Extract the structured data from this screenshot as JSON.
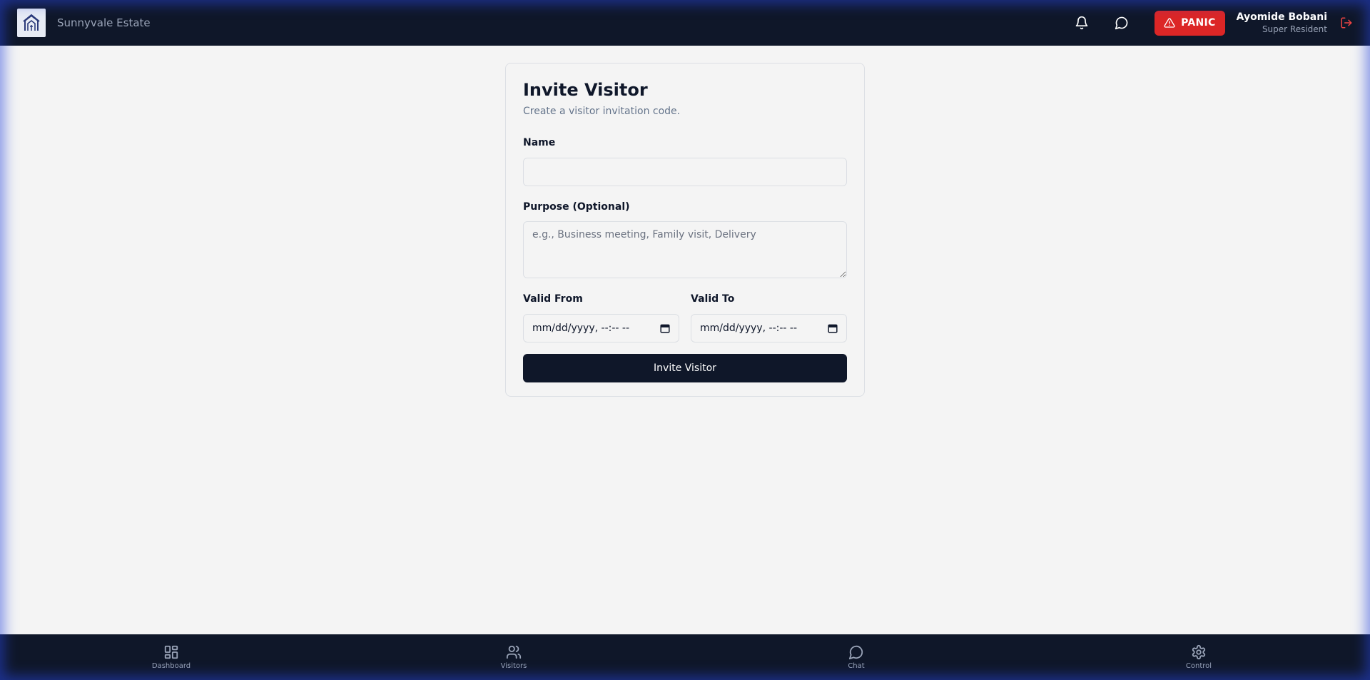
{
  "header": {
    "estate_name": "Sunnyvale Estate",
    "logo_icon": "estate-house-icon",
    "notification_icon": "bell-icon",
    "chat_icon": "chat-bubble-icon",
    "panic_label": "PANIC",
    "panic_icon": "warning-triangle-icon",
    "user_name": "Ayomide Bobani",
    "user_role": "Super Resident",
    "logout_icon": "logout-icon"
  },
  "form": {
    "title": "Invite Visitor",
    "subtitle": "Create a visitor invitation code.",
    "name_label": "Name",
    "name_value": "",
    "purpose_label": "Purpose (Optional)",
    "purpose_placeholder": "e.g., Business meeting, Family visit, Delivery",
    "valid_from_label": "Valid From",
    "valid_from_value": "mm/dd/yyyy, --:-- --",
    "valid_to_label": "Valid To",
    "valid_to_value": "mm/dd/yyyy, --:-- --",
    "calendar_icon": "calendar-icon",
    "submit_label": "Invite Visitor"
  },
  "bottom_nav": {
    "items": [
      {
        "label": "Dashboard",
        "icon": "dashboard-grid-icon"
      },
      {
        "label": "Visitors",
        "icon": "users-icon"
      },
      {
        "label": "Chat",
        "icon": "chat-bubble-icon"
      },
      {
        "label": "Control",
        "icon": "gear-icon"
      }
    ]
  },
  "colors": {
    "header_bg": "#0f1729",
    "page_bg": "#f4f4f4",
    "panic": "#dc2626",
    "logout": "#ef4444",
    "muted_text": "#64748b"
  }
}
